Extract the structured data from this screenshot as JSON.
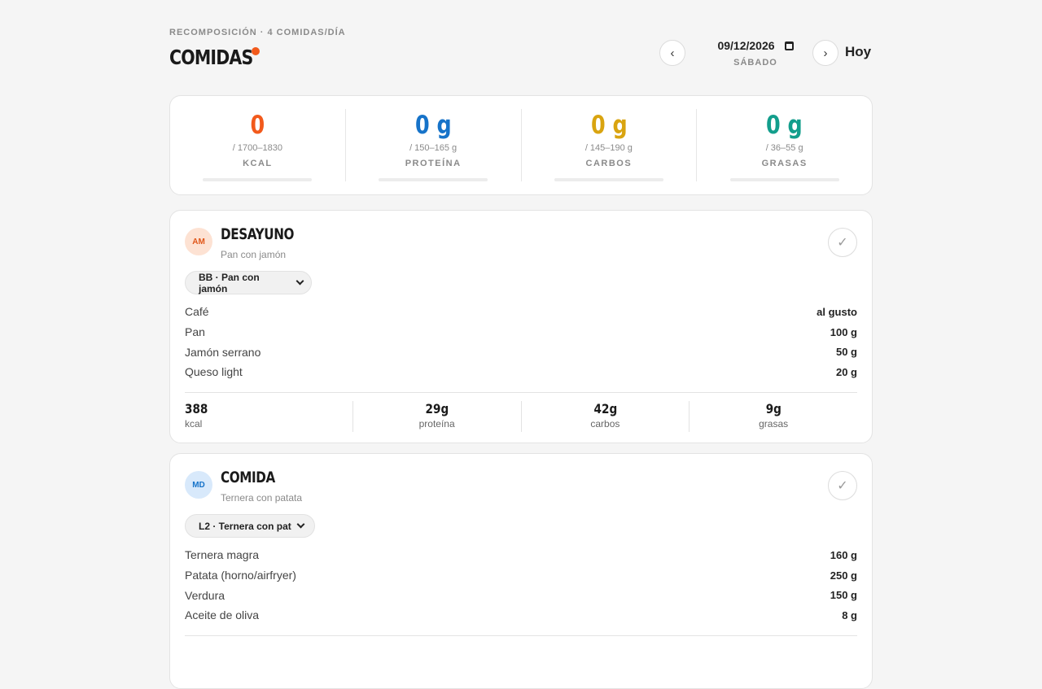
{
  "header": {
    "eyebrow": "RECOMPOSICIÓN · 4 COMIDAS/DÍA",
    "title": "COMIDAS",
    "prev_label": "‹",
    "next_label": "›",
    "date": "09/12/2026",
    "weekday": "SÁBADO",
    "today_label": "Hoy"
  },
  "colors": {
    "accent": "#f25a1c",
    "protein": "#1673c9",
    "carbs": "#d9a410",
    "fat": "#139e8c"
  },
  "summary": [
    {
      "value": "0",
      "range": "/ 1700–1830",
      "label": "KCAL"
    },
    {
      "value": "0 g",
      "range": "/ 150–165 g",
      "label": "PROTEÍNA"
    },
    {
      "value": "0 g",
      "range": "/ 145–190 g",
      "label": "CARBOS"
    },
    {
      "value": "0 g",
      "range": "/ 36–55 g",
      "label": "GRASAS"
    }
  ],
  "meals": [
    {
      "badge": "AM",
      "name": "DESAYUNO",
      "subtitle": "Pan con jamón",
      "selected_option": "BB · Pan con jamón",
      "check_icon": "✓",
      "items": [
        {
          "name": "Café",
          "qty": "al gusto"
        },
        {
          "name": "Pan",
          "qty": "100 g"
        },
        {
          "name": "Jamón serrano",
          "qty": "50 g"
        },
        {
          "name": "Queso light",
          "qty": "20 g"
        }
      ],
      "macros": [
        {
          "value": "388",
          "label": "kcal"
        },
        {
          "value": "29g",
          "label": "proteína"
        },
        {
          "value": "42g",
          "label": "carbos"
        },
        {
          "value": "9g",
          "label": "grasas"
        }
      ]
    },
    {
      "badge": "MD",
      "name": "COMIDA",
      "subtitle": "Ternera con patata",
      "selected_option": "L2 · Ternera con pat",
      "check_icon": "✓",
      "items": [
        {
          "name": "Ternera magra",
          "qty": "160 g"
        },
        {
          "name": "Patata (horno/airfryer)",
          "qty": "250 g"
        },
        {
          "name": "Verdura",
          "qty": "150 g"
        },
        {
          "name": "Aceite de oliva",
          "qty": "8 g"
        }
      ]
    }
  ]
}
